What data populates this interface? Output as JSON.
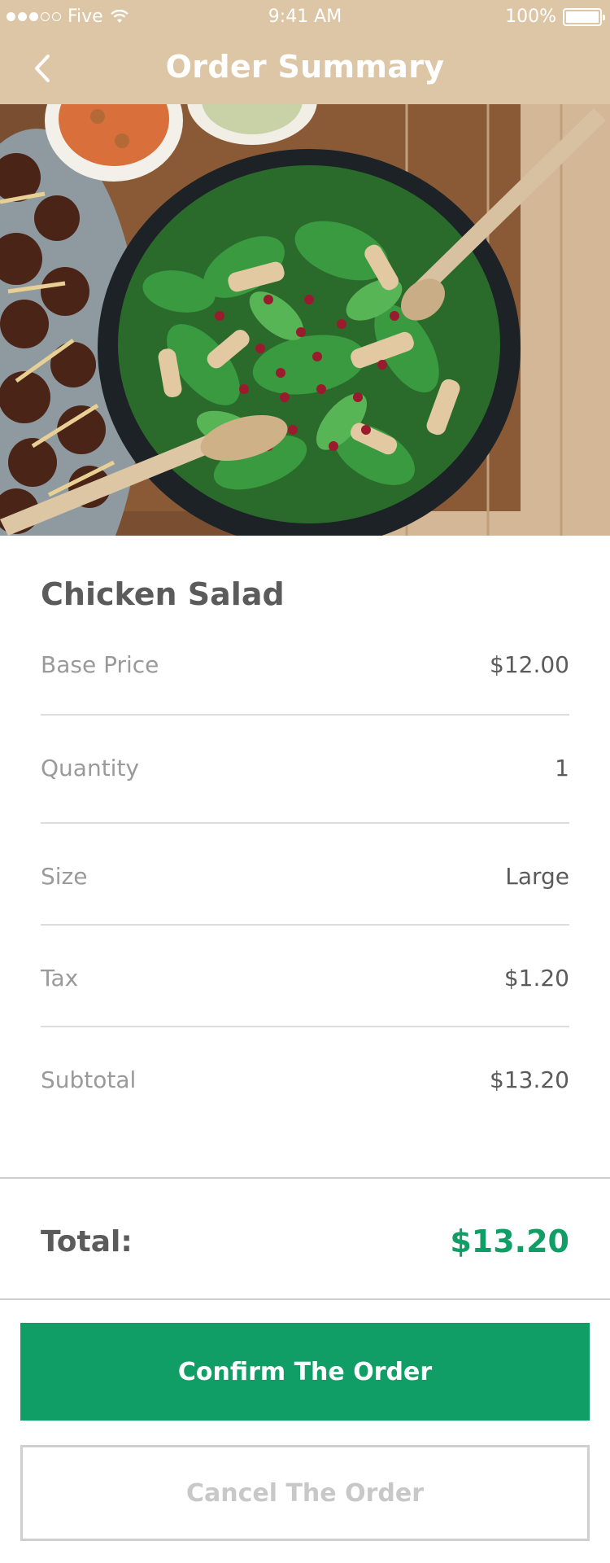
{
  "status_bar": {
    "carrier": "Five",
    "time": "9:41 AM",
    "battery": "100%"
  },
  "nav": {
    "title": "Order Summary",
    "back_icon": "chevron-left-icon"
  },
  "item": {
    "name": "Chicken Salad",
    "rows": [
      {
        "label": "Base Price",
        "value": "$12.00"
      },
      {
        "label": "Quantity",
        "value": "1"
      },
      {
        "label": "Size",
        "value": "Large"
      },
      {
        "label": "Tax",
        "value": "$1.20"
      },
      {
        "label": "Subtotal",
        "value": "$13.20"
      }
    ]
  },
  "total": {
    "label": "Total:",
    "value": "$13.20"
  },
  "actions": {
    "confirm_label": "Confirm The Order",
    "cancel_label": "Cancel The Order"
  },
  "colors": {
    "header": "#dcc6a6",
    "accent": "#119e66"
  }
}
